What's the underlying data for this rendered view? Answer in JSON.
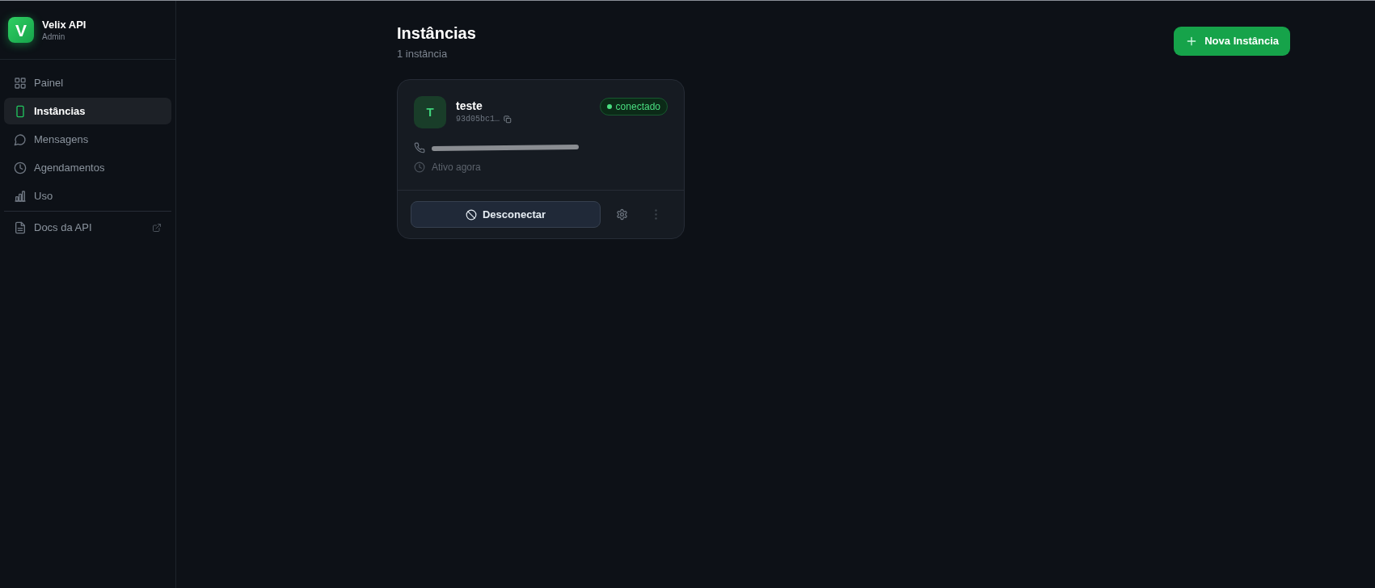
{
  "sidebar": {
    "brand": {
      "logo": "V",
      "title": "Velix API",
      "subtitle": "Admin"
    },
    "nav": [
      {
        "label": "Painel",
        "selected": false
      },
      {
        "label": "Instâncias",
        "selected": true
      },
      {
        "label": "Mensagens",
        "selected": false
      },
      {
        "label": "Agendamentos",
        "selected": false
      },
      {
        "label": "Uso",
        "selected": false
      }
    ],
    "links": [
      {
        "label": "Docs da API",
        "external": true
      }
    ]
  },
  "header": {
    "title": "Instâncias",
    "subtitle": "1 instância",
    "new_button": "Nova Instância"
  },
  "instances": [
    {
      "avatar": "T",
      "name": "teste",
      "id": "93d05bc1…",
      "status": {
        "label": "conectado",
        "connected": true
      },
      "activity": "Ativo agora",
      "action": "Desconectar"
    }
  ]
}
